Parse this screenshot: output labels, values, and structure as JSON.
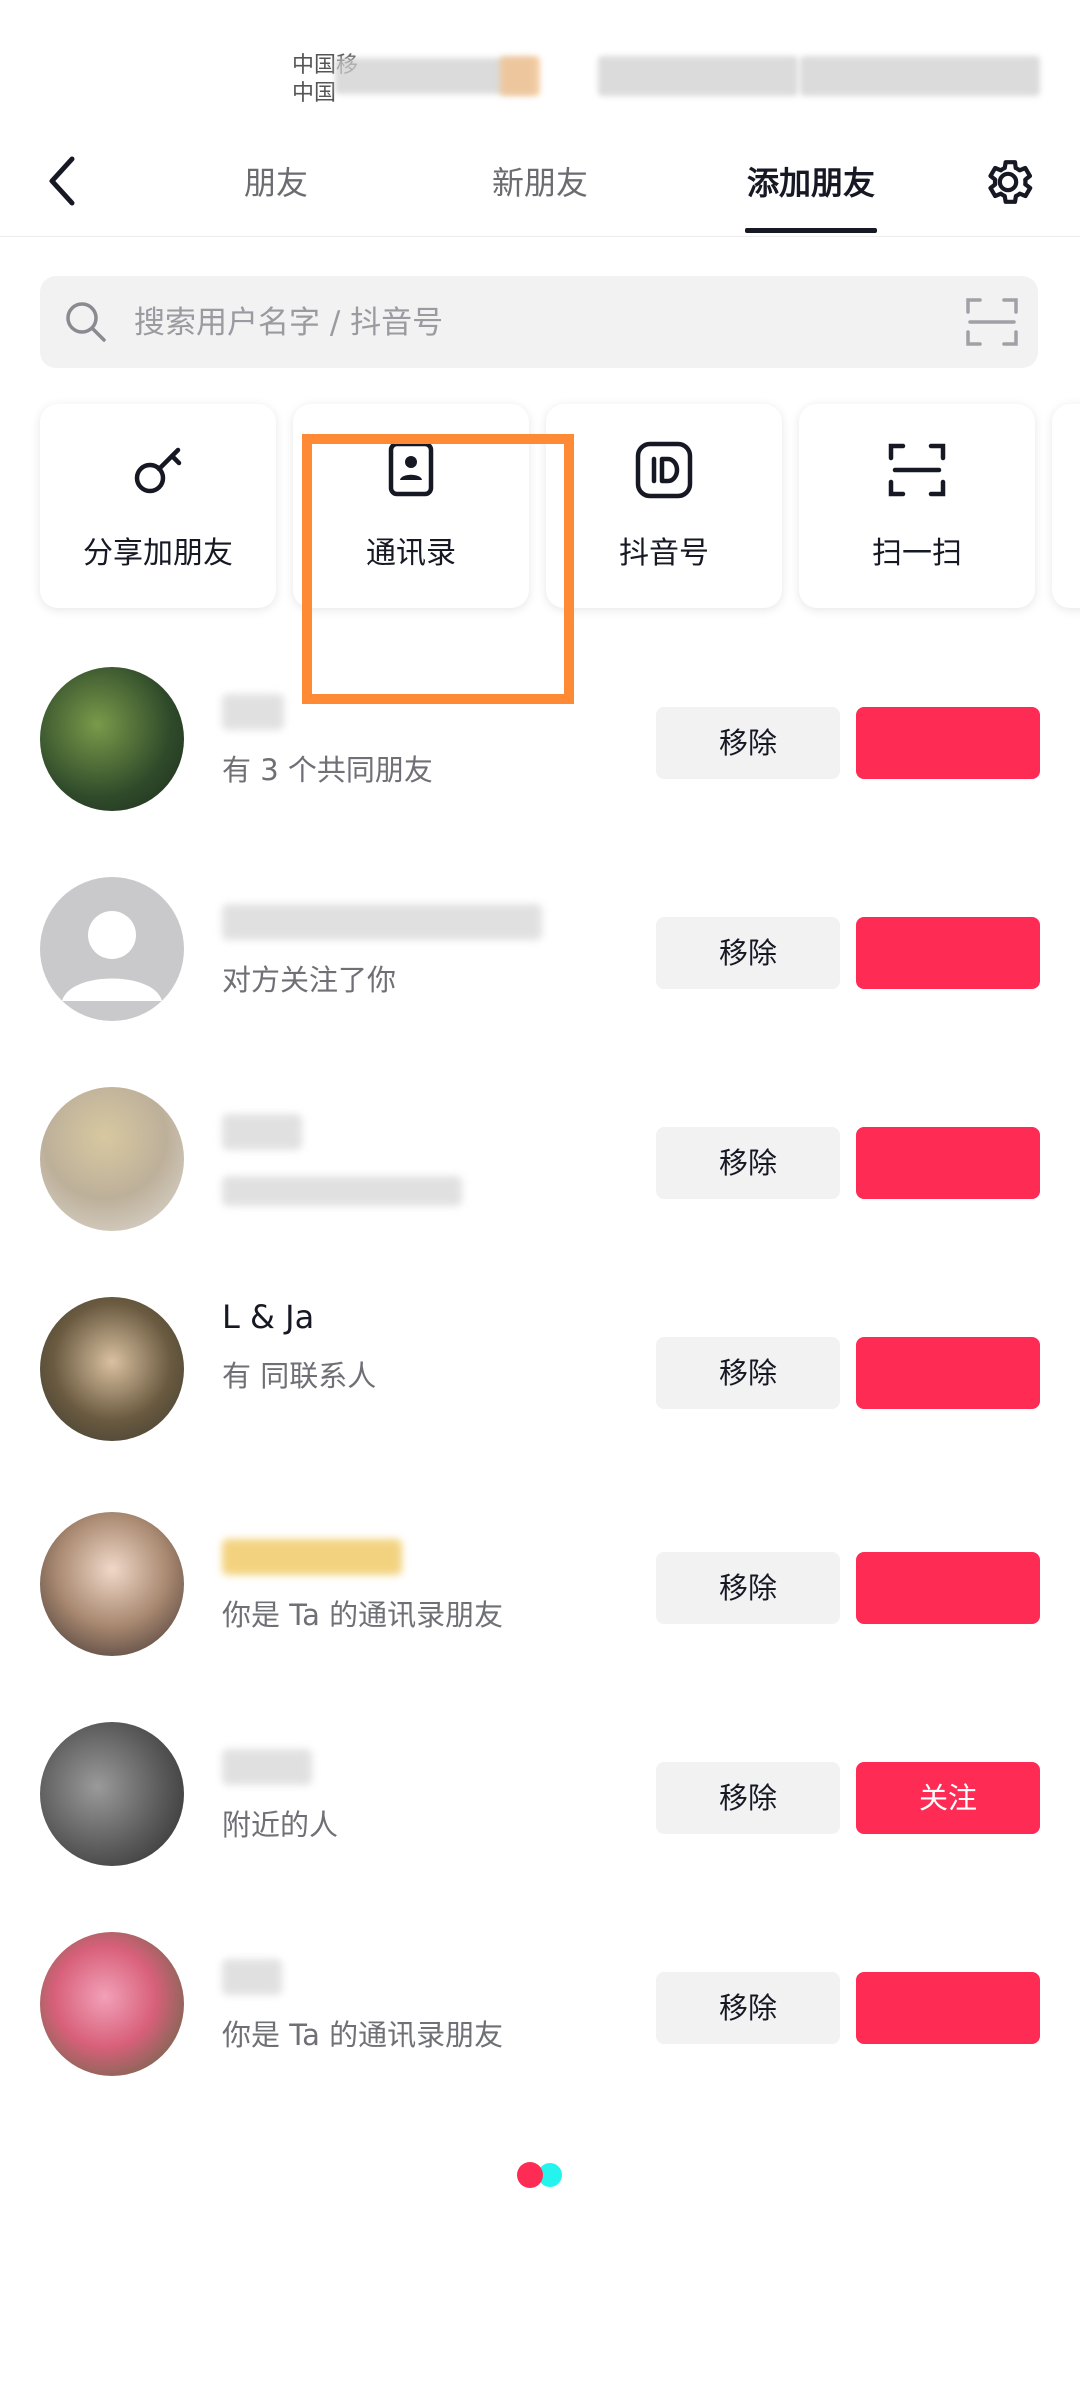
{
  "statusbar": {
    "carrier1": "中国移",
    "carrier2": "中国"
  },
  "nav": {
    "tabs": [
      {
        "label": "朋友"
      },
      {
        "label": "新朋友"
      },
      {
        "label": "添加朋友"
      }
    ],
    "active_tab": "添加朋友"
  },
  "search": {
    "placeholder": "搜索用户名字 / 抖音号",
    "value": ""
  },
  "actions": [
    {
      "label": "分享加朋友",
      "icon": "key-icon"
    },
    {
      "label": "通讯录",
      "icon": "contact-book-icon"
    },
    {
      "label": "抖音号",
      "icon": "id-badge-icon"
    },
    {
      "label": "扫一扫",
      "icon": "scan-icon"
    }
  ],
  "suggestions": [
    {
      "subtitle": "有 3 个共同朋友",
      "remove": "移除",
      "follow": ""
    },
    {
      "subtitle": "对方关注了你",
      "remove": "移除",
      "follow": ""
    },
    {
      "subtitle": "",
      "remove": "移除",
      "follow": ""
    },
    {
      "name": "L & Ja",
      "subtitle": "有 同联系人",
      "remove": "移除",
      "follow": ""
    },
    {
      "subtitle": "你是 Ta 的通讯录朋友",
      "remove": "移除",
      "follow": ""
    },
    {
      "subtitle": "附近的人",
      "remove": "移除",
      "follow": "关注"
    },
    {
      "subtitle": "你是 Ta 的通讯录朋友",
      "remove": "移除",
      "follow": ""
    }
  ],
  "colors": {
    "accent": "#fe2c55",
    "highlight": "#ff8a35",
    "loader_red": "#fe2c55",
    "loader_cyan": "#25f4ee"
  }
}
